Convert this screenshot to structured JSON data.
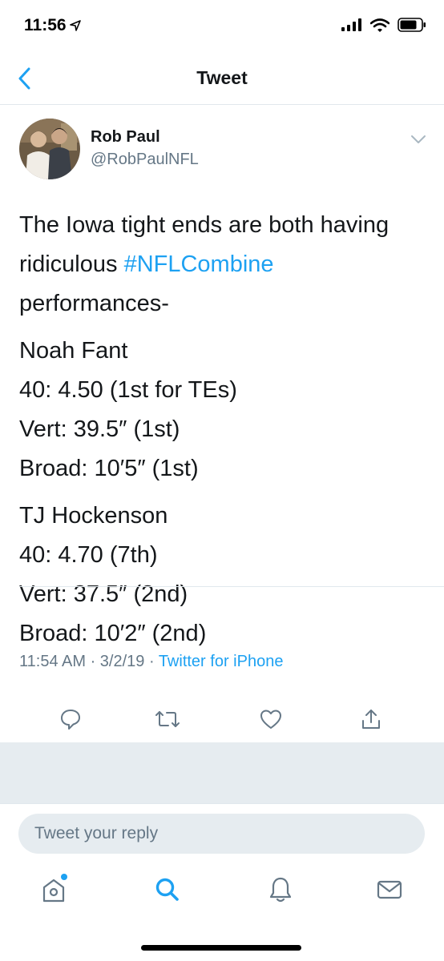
{
  "status_bar": {
    "time": "11:56",
    "icons": [
      "location-arrow-icon",
      "signal-icon",
      "wifi-icon",
      "battery-icon"
    ]
  },
  "nav": {
    "title": "Tweet",
    "back_icon": "chevron-left-icon"
  },
  "tweet": {
    "author_name": "Rob Paul",
    "author_handle": "@RobPaulNFL",
    "text_lines_1": [
      "The Iowa tight ends are both having"
    ],
    "text_line_2_prefix": "ridiculous ",
    "hashtag": "#NFLCombine",
    "text_line_3": "performances-",
    "block_fant": [
      "Noah Fant",
      "40: 4.50 (1st for TEs)",
      "Vert: 39.5″ (1st)",
      "Broad: 10′5″ (1st)"
    ],
    "block_hockenson": [
      "TJ Hockenson",
      "40: 4.70 (7th)",
      "Vert: 37.5″ (2nd)",
      "Broad: 10′2″ (2nd)"
    ],
    "timestamp": "11:54 AM · 3/2/19 · ",
    "source": "Twitter for iPhone"
  },
  "actions": [
    "reply-icon",
    "retweet-icon",
    "like-icon",
    "share-icon"
  ],
  "reply": {
    "placeholder": "Tweet your reply"
  },
  "tab_bar": [
    "home-icon",
    "search-icon",
    "notifications-icon",
    "messages-icon"
  ],
  "colors": {
    "accent": "#1da1f2",
    "secondary_text": "#657786",
    "primary_text": "#14171a",
    "band": "#e6ecf0"
  }
}
